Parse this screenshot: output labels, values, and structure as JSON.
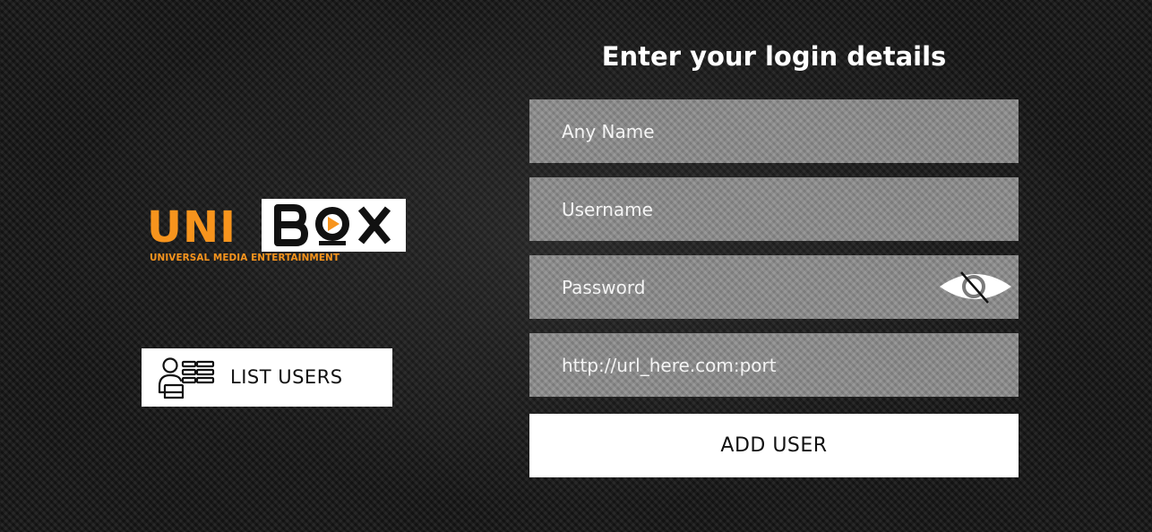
{
  "logo": {
    "uni_text": "UNI",
    "box_text": "BOX",
    "tagline": "UNIVERSAL MEDIA ENTERTAINMENT",
    "brand_orange": "#f7941d"
  },
  "sidebar": {
    "list_users_label": "LIST USERS",
    "list_users_icon": "user-list-icon"
  },
  "form": {
    "title": "Enter your login details",
    "any_name_placeholder": "Any Name",
    "username_placeholder": "Username",
    "password_placeholder": "Password",
    "url_placeholder": "http://url_here.com:port",
    "password_toggle_icon": "eye-slash-icon",
    "submit_label": "ADD USER"
  }
}
